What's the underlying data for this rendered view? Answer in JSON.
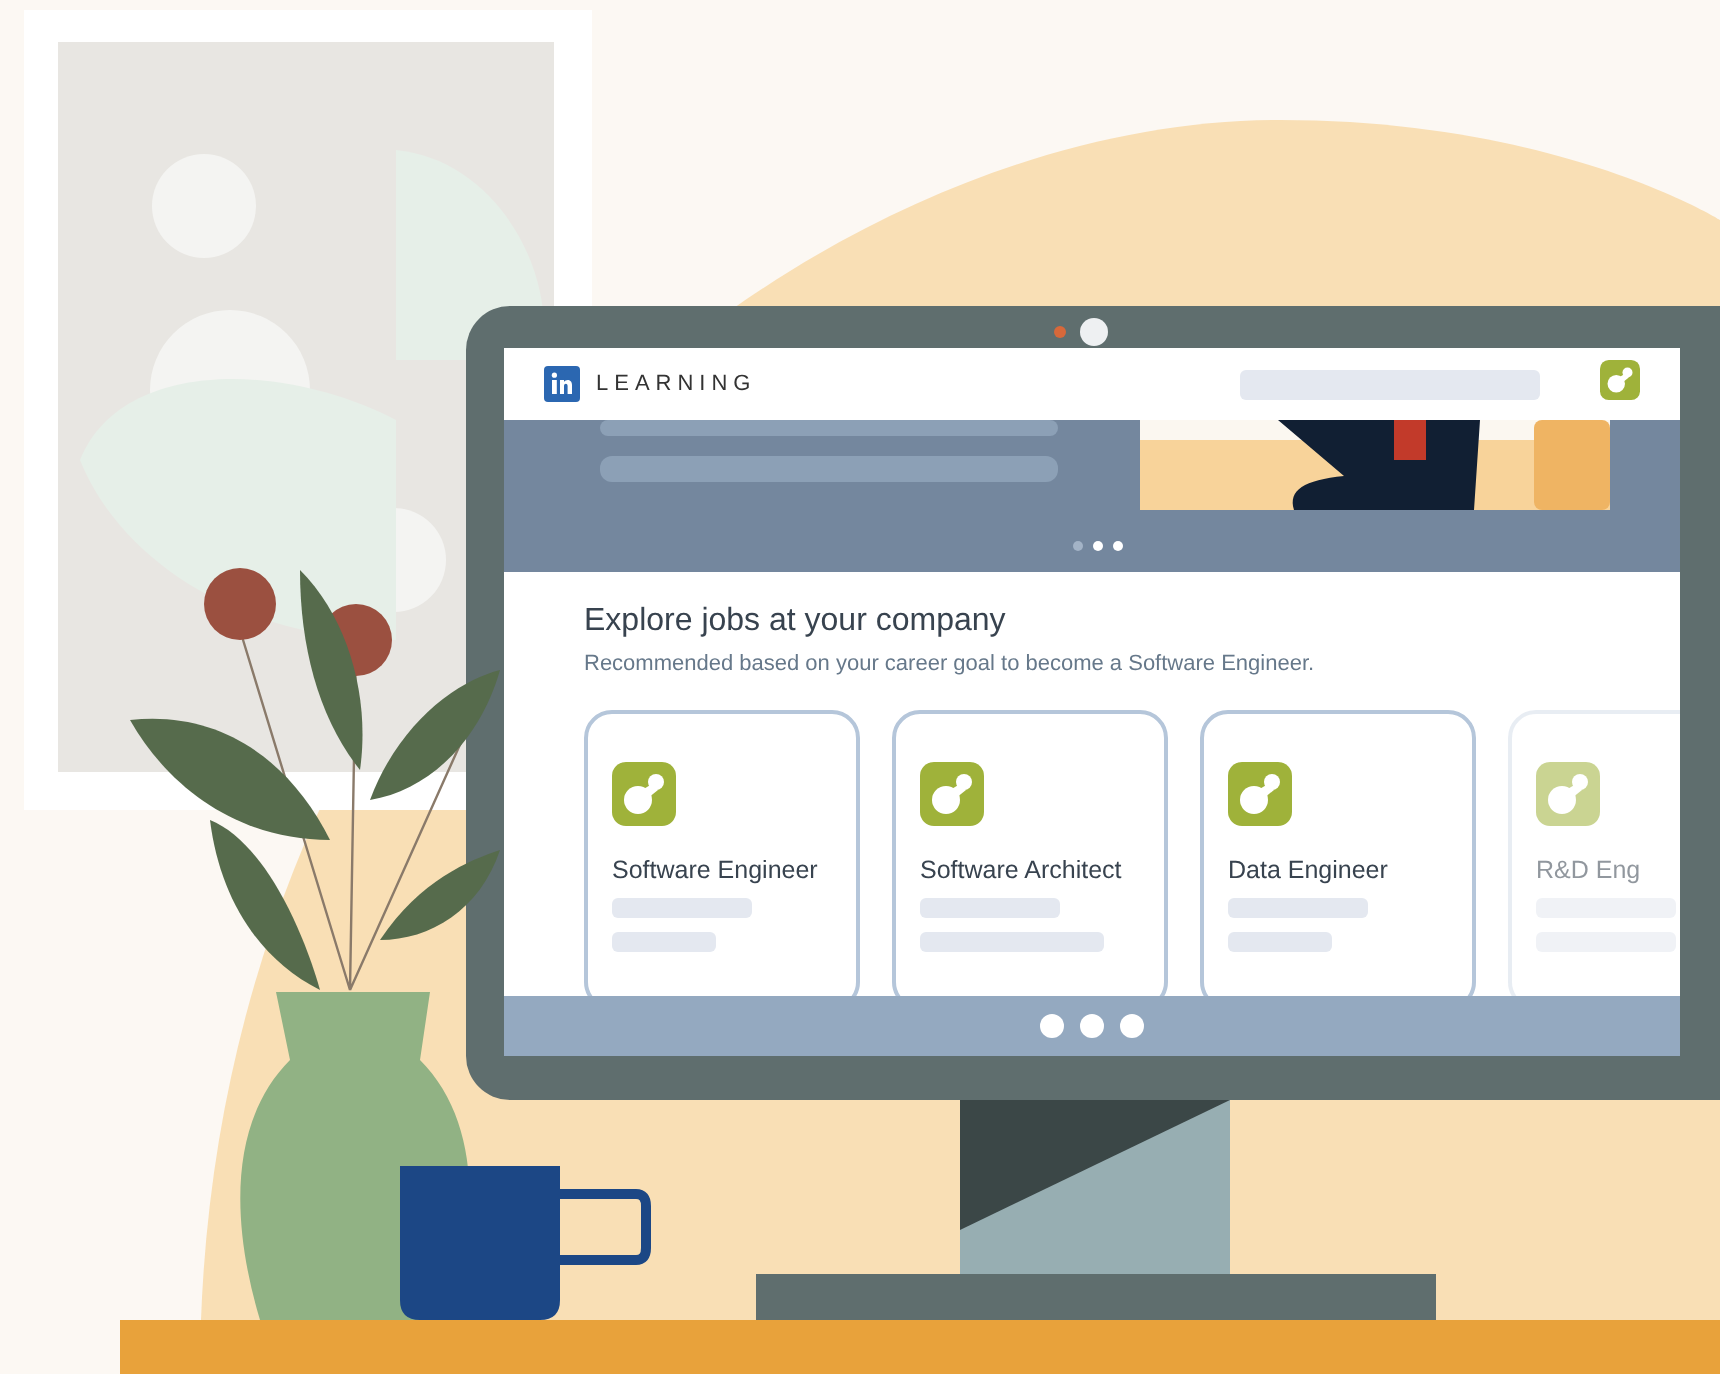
{
  "header": {
    "logo_text": "LEARNING"
  },
  "section": {
    "title": "Explore jobs at your company",
    "subtitle": "Recommended based on your career goal to become a Software Engineer."
  },
  "jobs": [
    {
      "title": "Software Engineer",
      "faded": false
    },
    {
      "title": "Software Architect",
      "faded": false
    },
    {
      "title": "Data Engineer",
      "faded": false
    },
    {
      "title": "R&D Eng",
      "faded": true
    }
  ]
}
